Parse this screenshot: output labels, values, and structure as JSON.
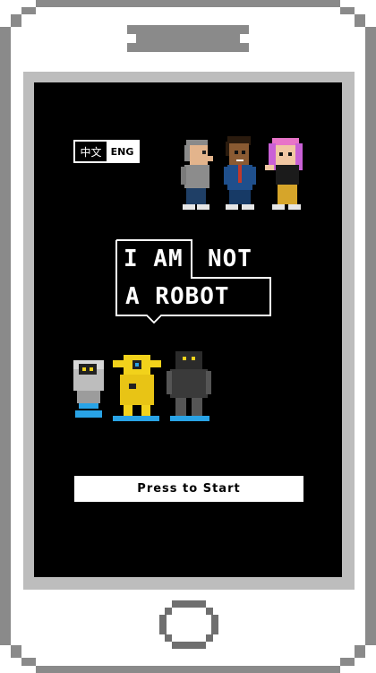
{
  "language": {
    "chinese_label": "中文",
    "english_label": "ENG",
    "selected": "ENG"
  },
  "title": {
    "line1_left": "I AM",
    "line1_right": "NOT",
    "line2": "A ROBOT"
  },
  "humans": [
    "man-gray-hair",
    "man-blue-suit",
    "woman-pink-hair"
  ],
  "robots": [
    "white-hover-robot",
    "yellow-robot",
    "black-robot"
  ],
  "start_button": {
    "label": "Press to Start"
  },
  "colors": {
    "screen": "#000000",
    "frame": "#8a8a8a",
    "frame_light": "#bdbdbd",
    "accent_yellow": "#f2d21b",
    "accent_blue": "#29a3e6"
  }
}
